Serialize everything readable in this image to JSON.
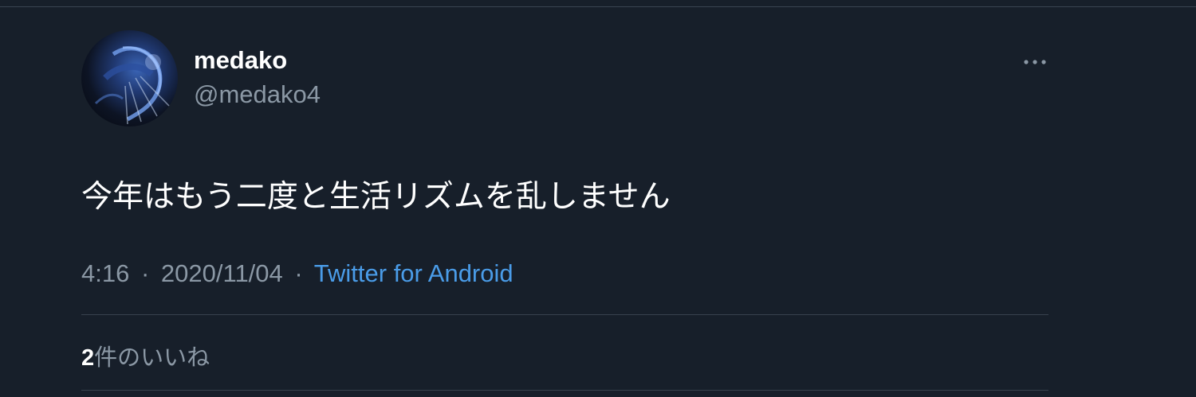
{
  "tweet": {
    "display_name": "medako",
    "handle": "@medako4",
    "text": "今年はもう二度と生活リズムを乱しません",
    "time": "4:16",
    "date": "2020/11/04",
    "separator": "·",
    "source": "Twitter for Android",
    "likes_count": "2",
    "likes_label": "件のいいね"
  },
  "icons": {
    "more": "more-horizontal-icon",
    "avatar": "profile-avatar"
  },
  "colors": {
    "background": "#171f2a",
    "link": "#4a9ce8",
    "secondary_text": "#8b98a5",
    "divider": "#38414d"
  }
}
